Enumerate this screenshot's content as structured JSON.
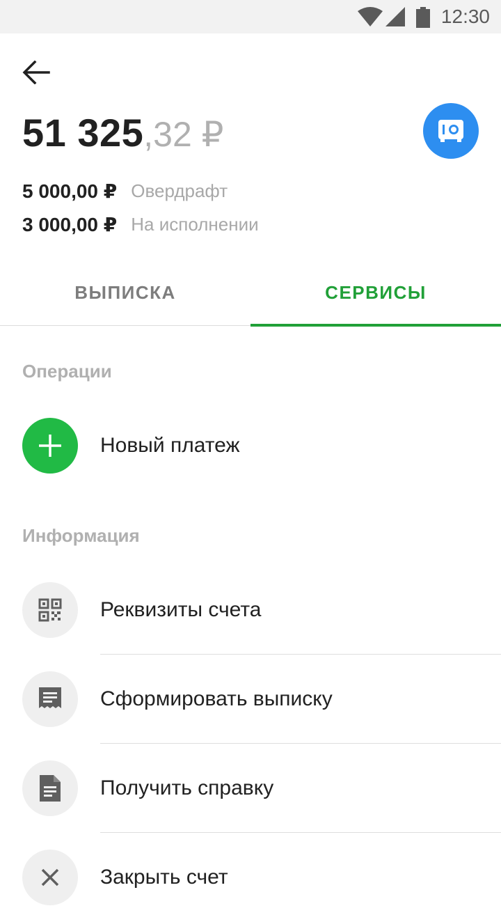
{
  "status_bar": {
    "time": "12:30",
    "icons": [
      "wifi-icon",
      "signal-icon",
      "battery-icon"
    ]
  },
  "header": {
    "back_icon": "arrow-left-icon",
    "balance_integer": "51 325",
    "balance_fraction": ",32 ₽",
    "safe_icon": "safe-icon"
  },
  "details": [
    {
      "amount": "5 000,00 ₽",
      "label": "Овердрафт"
    },
    {
      "amount": "3 000,00 ₽",
      "label": "На исполнении"
    }
  ],
  "tabs": [
    {
      "label": "ВЫПИСКА",
      "active": false
    },
    {
      "label": "СЕРВИСЫ",
      "active": true
    }
  ],
  "sections": {
    "operations": {
      "title": "Операции",
      "items": [
        {
          "label": "Новый платеж",
          "icon": "plus-icon"
        }
      ]
    },
    "information": {
      "title": "Информация",
      "items": [
        {
          "label": "Реквизиты счета",
          "icon": "qr-code-icon"
        },
        {
          "label": "Сформировать выписку",
          "icon": "receipt-icon"
        },
        {
          "label": "Получить справку",
          "icon": "document-icon"
        },
        {
          "label": "Закрыть счет",
          "icon": "close-icon"
        }
      ]
    }
  },
  "colors": {
    "accent_green": "#21a038",
    "action_green": "#21ba45",
    "safe_blue": "#2d8ef0",
    "muted_text": "#b0b0b0"
  }
}
